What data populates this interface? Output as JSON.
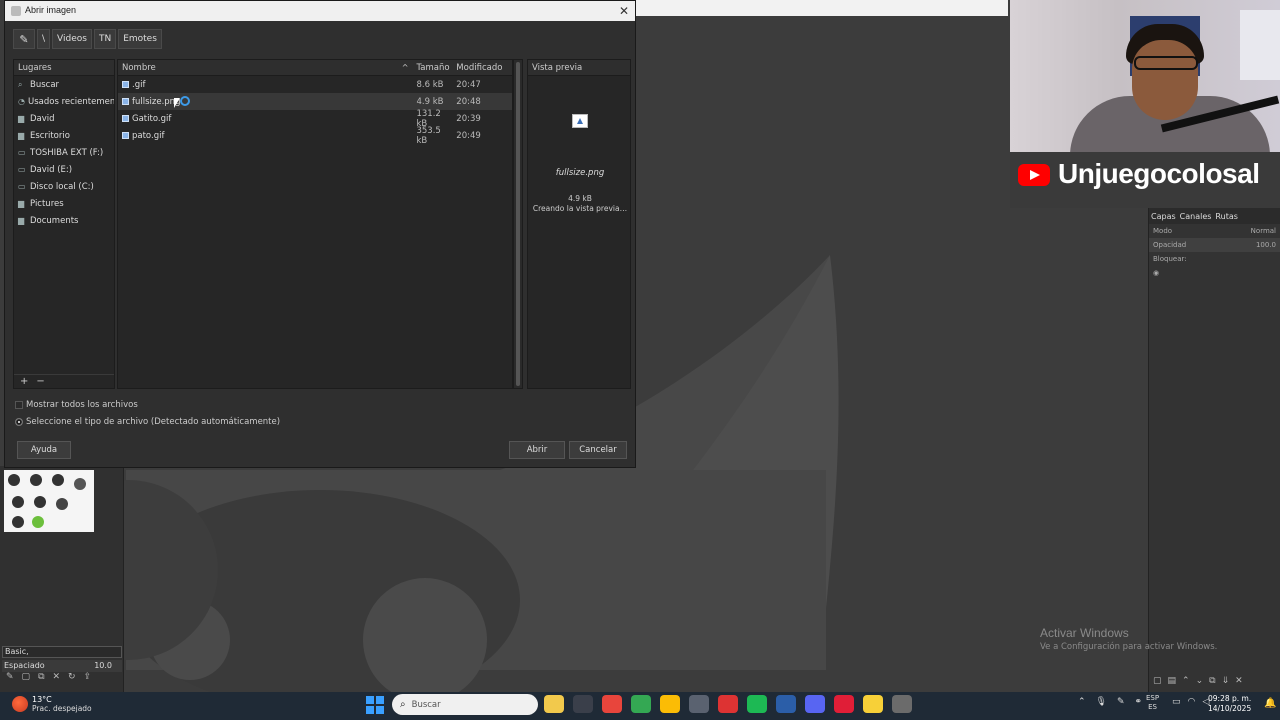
{
  "dialog": {
    "title": "Abrir imagen",
    "close_icon": "✕",
    "path": [
      "\\",
      "Videos",
      "TN",
      "Emotes"
    ],
    "places": {
      "header": "Lugares",
      "items": [
        {
          "icon": "search-icon",
          "glyph": "⌕",
          "label": "Buscar"
        },
        {
          "icon": "recent-icon",
          "glyph": "◔",
          "label": "Usados recientemente"
        },
        {
          "icon": "folder-icon",
          "glyph": "▆",
          "label": "David"
        },
        {
          "icon": "folder-icon",
          "glyph": "▆",
          "label": "Escritorio"
        },
        {
          "icon": "drive-icon",
          "glyph": "▭",
          "label": "TOSHIBA EXT (F:)"
        },
        {
          "icon": "drive-icon",
          "glyph": "▭",
          "label": "David (E:)"
        },
        {
          "icon": "drive-icon",
          "glyph": "▭",
          "label": "Disco local (C:)"
        },
        {
          "icon": "folder-icon",
          "glyph": "▆",
          "label": "Pictures"
        },
        {
          "icon": "folder-icon",
          "glyph": "▆",
          "label": "Documents"
        }
      ],
      "add_label": "+",
      "remove_label": "−"
    },
    "files": {
      "col_name": "Nombre",
      "col_size": "Tamaño",
      "col_modified": "Modificado",
      "rows": [
        {
          "name": ".gif",
          "size": "8.6 kB",
          "modified": "20:47",
          "selected": false
        },
        {
          "name": "fullsize.png",
          "size": "4.9 kB",
          "modified": "20:48",
          "selected": true
        },
        {
          "name": "Gatito.gif",
          "size": "131.2 kB",
          "modified": "20:39",
          "selected": false
        },
        {
          "name": "pato.gif",
          "size": "353.5 kB",
          "modified": "20:49",
          "selected": false
        }
      ]
    },
    "preview": {
      "header": "Vista previa",
      "filename": "fullsize.png",
      "size": "4.9 kB",
      "status": "Creando la vista previa…"
    },
    "show_all_label": "Mostrar todos los archivos",
    "file_type_label": "Seleccione el tipo de archivo (Detectado automáticamente)",
    "help_button": "Ayuda",
    "open_button": "Abrir",
    "cancel_button": "Cancelar"
  },
  "gimp": {
    "brush_preset": "Basic,",
    "spacing_label": "Espaciado",
    "spacing_value": "10.0",
    "dock": {
      "tabs": [
        "Capas",
        "Canales",
        "Rutas"
      ],
      "mode_label": "Modo",
      "mode_value": "Normal",
      "opacity_label": "Opacidad",
      "opacity_value": "100.0",
      "lock_label": "Bloquear:"
    }
  },
  "overlay": {
    "channel_name": "Unjuegocolosal",
    "activate_title": "Activar Windows",
    "activate_sub": "Ve a Configuración para activar Windows."
  },
  "taskbar": {
    "temperature": "13°C",
    "weather_desc": "Prac. despejado",
    "search_placeholder": "Buscar",
    "lang_top": "ESP",
    "lang_bottom": "ES",
    "time": "09:28 p. m.",
    "date": "14/10/2025",
    "apps": [
      {
        "name": "file-explorer-icon",
        "color": "#f2c94c"
      },
      {
        "name": "store-icon",
        "color": "#3a3f4a"
      },
      {
        "name": "chrome-icon",
        "color": "#e8453c"
      },
      {
        "name": "chrome-2-icon",
        "color": "#34a853"
      },
      {
        "name": "chrome-3-icon",
        "color": "#fbbc05"
      },
      {
        "name": "settings-icon",
        "color": "#5a6270"
      },
      {
        "name": "app-red-icon",
        "color": "#d33"
      },
      {
        "name": "xbox-icon",
        "color": "#1db954"
      },
      {
        "name": "terminal-icon",
        "color": "#2b5ea8"
      },
      {
        "name": "discord-icon",
        "color": "#5865f2"
      },
      {
        "name": "opera-icon",
        "color": "#e01e37"
      },
      {
        "name": "sticky-notes-icon",
        "color": "#f7d038"
      },
      {
        "name": "gimp-icon",
        "color": "#6b6b6b"
      }
    ]
  }
}
